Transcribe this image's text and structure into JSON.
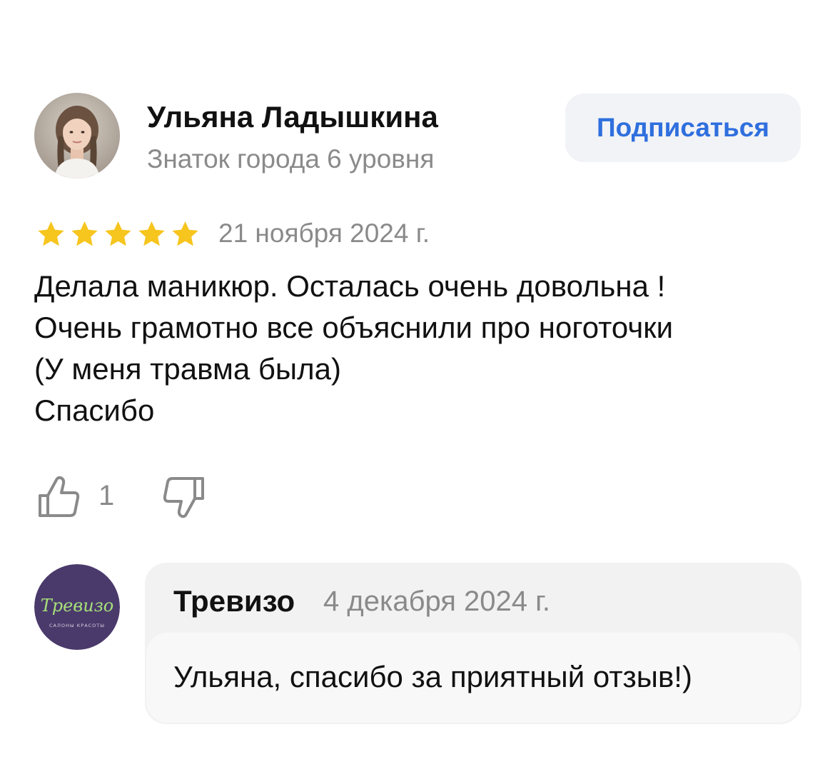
{
  "review": {
    "author": {
      "name": "Ульяна Ладышкина",
      "level": "Знаток города 6 уровня",
      "avatar_icon": "user-photo-avatar"
    },
    "subscribe_label": "Подписаться",
    "rating": 5,
    "rating_max": 5,
    "star_color": "#f6c51e",
    "date": "21 ноября 2024 г.",
    "text_lines": [
      "Делала маникюр. Осталась очень довольна !",
      "Очень грамотно все объяснили про ноготочки",
      "(У меня травма была)",
      "Спасибо"
    ],
    "likes": "1",
    "like_icon": "thumbs-up-icon",
    "dislike_icon": "thumbs-down-icon"
  },
  "reply": {
    "business_name": "Тревизо",
    "logo": {
      "script_text": "Тревизо",
      "tagline": "САЛОНЫ КРАСОТЫ",
      "bg_color": "#4a3a6b",
      "text_color": "#a6e07a"
    },
    "date": "4 декабря 2024 г.",
    "text": "Ульяна, спасибо за приятный отзыв!)"
  },
  "colors": {
    "accent_blue": "#2f6fde",
    "secondary_text": "#8a8a8a",
    "button_bg": "#f1f3f6",
    "reply_bg": "#f2f2f2"
  }
}
